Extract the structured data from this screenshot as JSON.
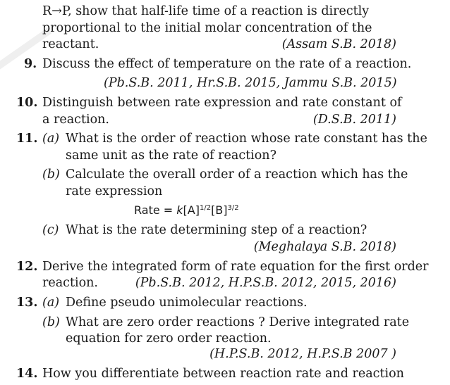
{
  "q8": {
    "line1": "R→P, show that half-life time of a reaction is directly",
    "line2": "proportional to the initial molar concentration of the",
    "line3": "reactant.",
    "cite": "(Assam S.B. 2018)"
  },
  "q9": {
    "num": "9.",
    "text": "Discuss the effect of temperature on the rate of a reaction.",
    "cite": "(Pb.S.B. 2011, Hr.S.B. 2015, Jammu S.B. 2015)"
  },
  "q10": {
    "num": "10.",
    "line1": "Distinguish between rate expression and rate constant of",
    "line2": "a reaction.",
    "cite": "(D.S.B. 2011)"
  },
  "q11": {
    "num": "11.",
    "a_label": "(a)",
    "a_line1": "What is the order of reaction whose rate constant has the",
    "a_line2": "same unit as the rate of reaction?",
    "b_label": "(b)",
    "b_line1": "Calculate the overall order of a reaction which has the",
    "b_line2": "rate expression",
    "eq_prefix": "Rate = ",
    "eq_k": "k",
    "eq_A": "[A]",
    "eq_A_exp": "1/2",
    "eq_B": "[B]",
    "eq_B_exp": "3/2",
    "c_label": "(c)",
    "c_line1": "What is the rate determining step of a reaction?",
    "cite": "(Meghalaya S.B. 2018)"
  },
  "q12": {
    "num": "12.",
    "line1": "Derive the integrated form of rate equation for the first order",
    "line2": "reaction.",
    "cite": "(Pb.S.B. 2012, H.P.S.B. 2012, 2015, 2016)"
  },
  "q13": {
    "num": "13.",
    "a_label": "(a)",
    "a_line1": "Define pseudo unimolecular reactions.",
    "b_label": "(b)",
    "b_line1": "What are zero order reactions ? Derive integrated rate",
    "b_line2": "equation for zero order reaction.",
    "cite": "(H.P.S.B. 2012, H.P.S.B 2007 )"
  },
  "q14": {
    "num": "14.",
    "line1": "How you differentiate between reaction rate and reaction"
  }
}
